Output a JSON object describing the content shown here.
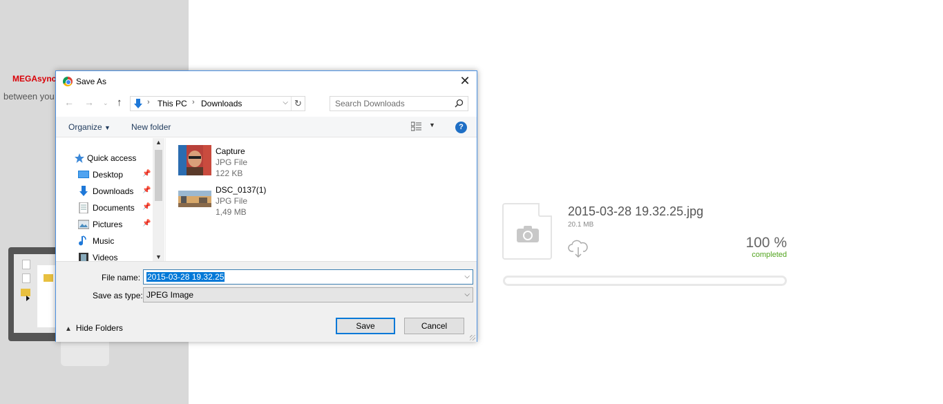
{
  "background": {
    "mega_title": "MEGAsync",
    "mega_subtitle": "between you"
  },
  "download": {
    "file_name": "2015-03-28 19.32.25.jpg",
    "file_size": "20.1 MB",
    "percent_text": "100 %",
    "status_text": "completed",
    "progress_fraction": 1.0,
    "status_color": "#52a41f"
  },
  "dialog": {
    "title": "Save As",
    "close_icon": "close-icon",
    "address": {
      "crumbs": [
        "This PC",
        "Downloads"
      ]
    },
    "search": {
      "placeholder": "Search Downloads"
    },
    "toolbar": {
      "organize_label": "Organize",
      "new_folder_label": "New folder",
      "help_label": "?"
    },
    "nav_items": [
      {
        "label": "Quick access",
        "icon": "star-icon",
        "pinned": false
      },
      {
        "label": "Desktop",
        "icon": "desktop-icon",
        "pinned": true
      },
      {
        "label": "Downloads",
        "icon": "download-arrow-icon",
        "pinned": true
      },
      {
        "label": "Documents",
        "icon": "documents-icon",
        "pinned": true
      },
      {
        "label": "Pictures",
        "icon": "pictures-icon",
        "pinned": true
      },
      {
        "label": "Music",
        "icon": "music-icon",
        "pinned": false
      },
      {
        "label": "Videos",
        "icon": "videos-icon",
        "pinned": false
      }
    ],
    "files": [
      {
        "name": "Capture",
        "type": "JPG File",
        "size": "122 KB"
      },
      {
        "name": "DSC_0137(1)",
        "type": "JPG File",
        "size": "1,49 MB"
      }
    ],
    "file_name_label": "File name:",
    "file_name_value": "2015-03-28 19.32.25",
    "save_type_label": "Save as type:",
    "save_type_value": "JPEG Image",
    "hide_folders_label": "Hide Folders",
    "save_label": "Save",
    "cancel_label": "Cancel"
  }
}
